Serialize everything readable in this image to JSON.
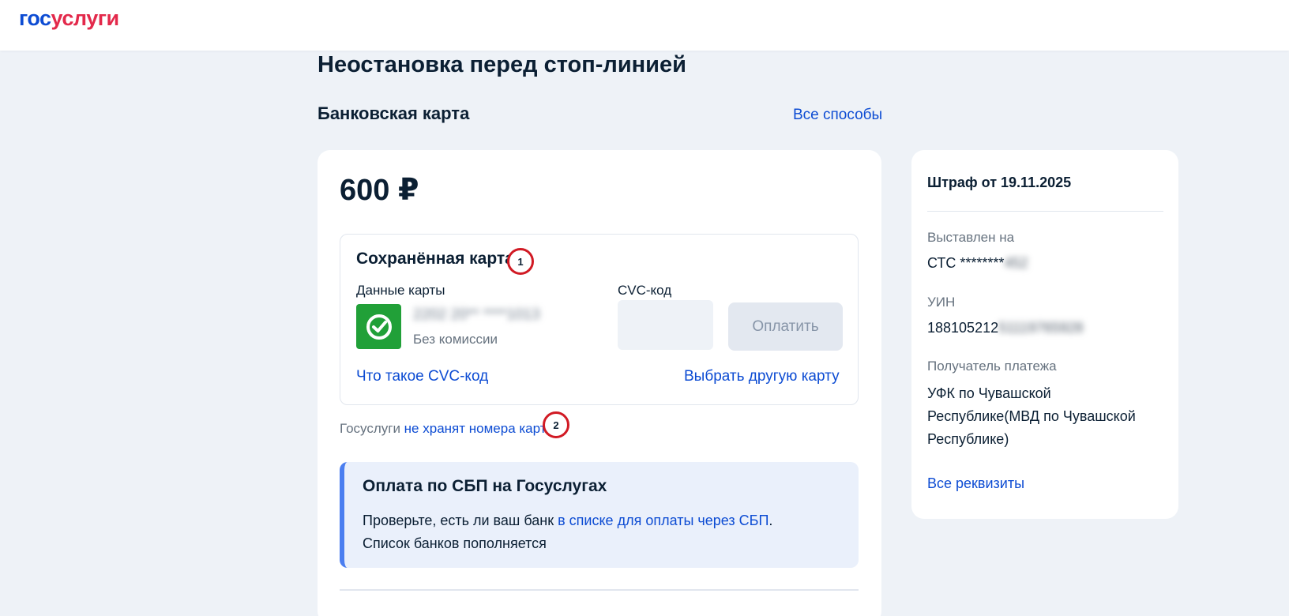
{
  "header": {
    "logo_part1": "гос",
    "logo_part2": "услуги"
  },
  "colors": {
    "accent": "#0d4cd3",
    "logo_red": "#e3294b",
    "annotation_marker": "#d11a24",
    "bank_green": "#21a038"
  },
  "page": {
    "title": "Неостановка перед стоп-линией"
  },
  "payment": {
    "method_title": "Банковская карта",
    "all_methods_link": "Все способы",
    "amount": "600 ₽",
    "saved_card": {
      "title": "Сохранённая карта",
      "card_data_label": "Данные карты",
      "bank_icon": "sber-check-icon",
      "card_number_masked": "2202 20** ****1013",
      "no_fee": "Без комиссии",
      "cvc_label": "CVC-код",
      "cvc_value": "",
      "pay_button": "Оплатить",
      "what_is_cvc_link": "Что такое CVC-код",
      "choose_other_card_link": "Выбрать другую карту"
    },
    "note": {
      "prefix": "Госуслуги ",
      "link": "не хранят номера карт"
    },
    "sbp": {
      "title": "Оплата по СБП на Госуслугах",
      "text_prefix": "Проверьте, есть ли ваш банк ",
      "text_link": "в списке для оплаты через СБП",
      "text_suffix": ".",
      "text_line2": "Список банков пополняется"
    }
  },
  "annotations": {
    "marker1": "1",
    "marker2": "2"
  },
  "fine": {
    "title": "Штраф от 19.11.2025",
    "issued_to_label": "Выставлен на",
    "issued_to_prefix": "СТС ********",
    "issued_to_hidden": "452",
    "uin_label": "УИН",
    "uin_prefix": "188105212",
    "uin_hidden": "51119765928",
    "recipient_label": "Получатель платежа",
    "recipient_value": "УФК по Чувашской Республике(МВД по Чувашской Республике)",
    "all_details_link": "Все реквизиты"
  }
}
